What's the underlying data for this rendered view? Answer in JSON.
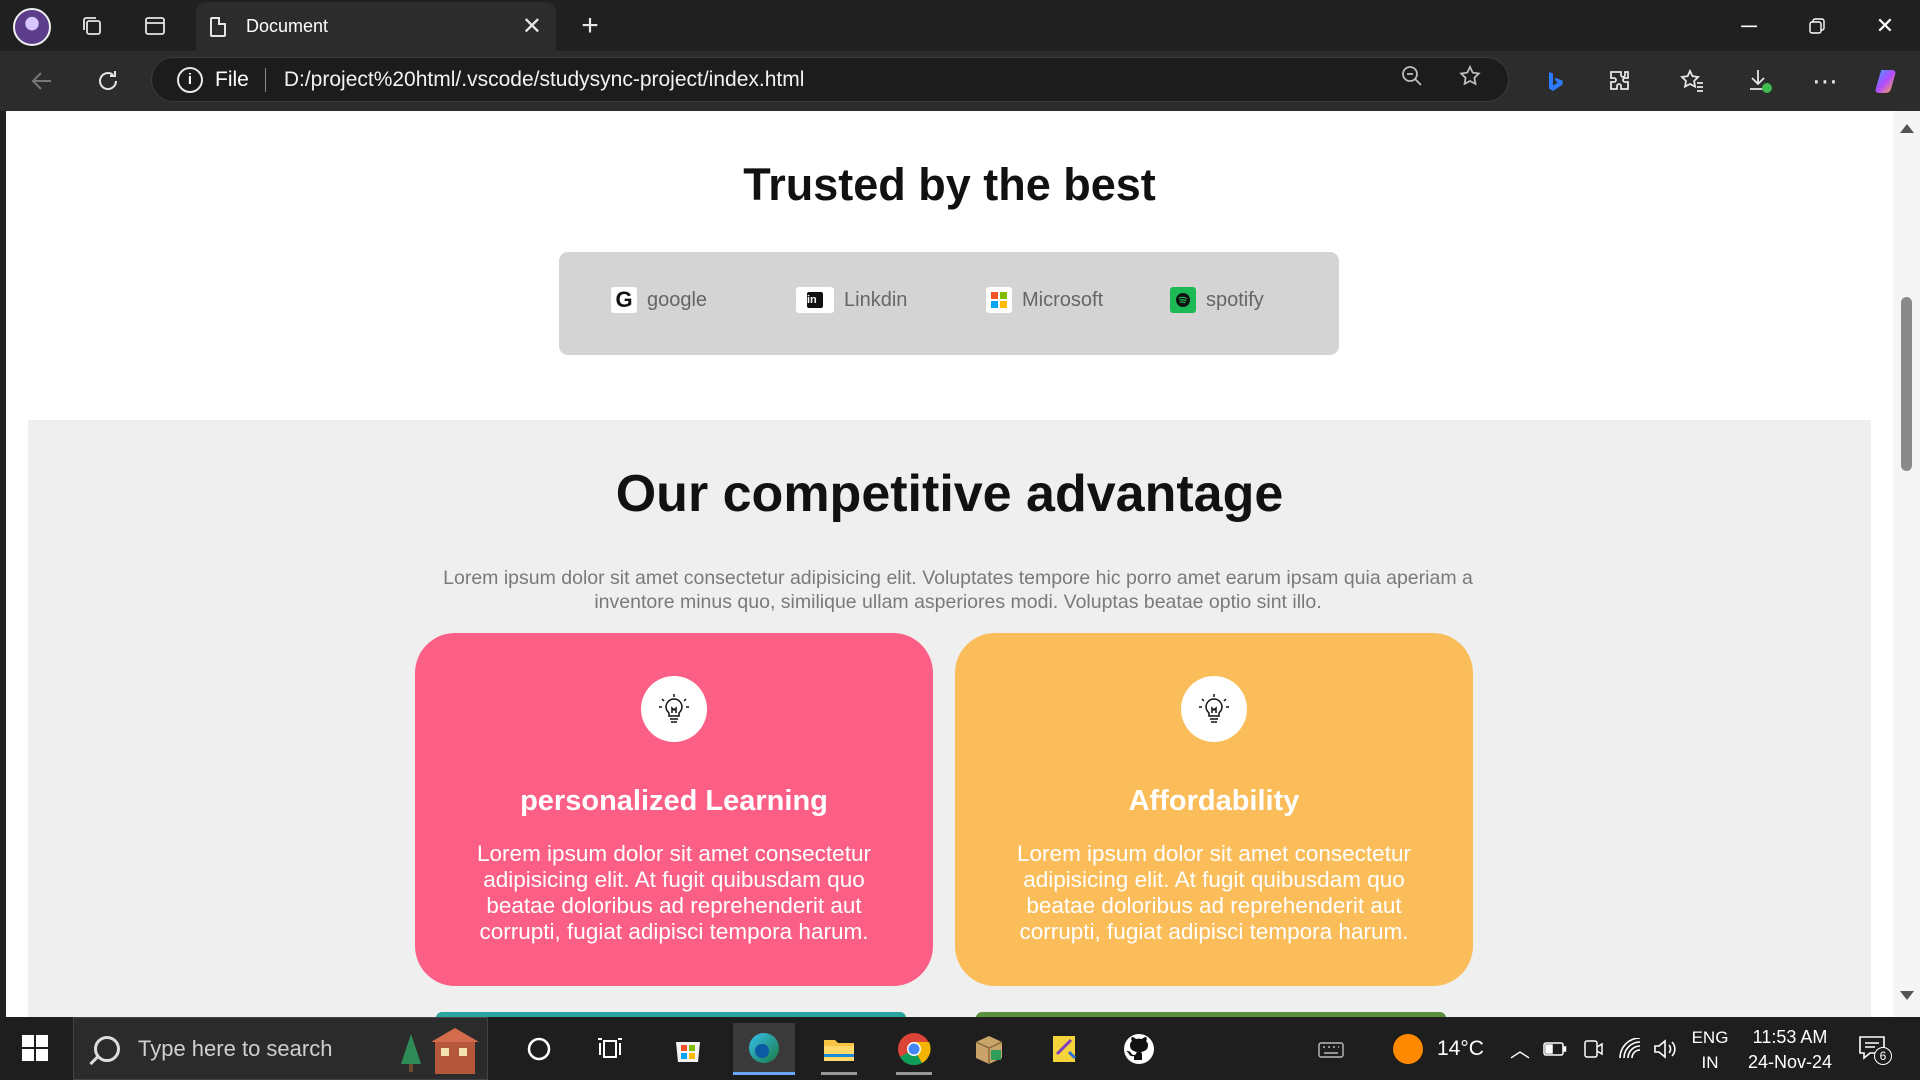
{
  "browser": {
    "tab_title": "Document",
    "omnibox_scheme": "File",
    "url": "D:/project%20html/.vscode/studysync-project/index.html"
  },
  "page": {
    "trusted_title": "Trusted by the best",
    "logos": [
      {
        "name": "google",
        "icon": "google-icon"
      },
      {
        "name": "Linkdin",
        "icon": "linkedin-icon"
      },
      {
        "name": "Microsoft",
        "icon": "microsoft-icon"
      },
      {
        "name": "spotify",
        "icon": "spotify-icon"
      }
    ],
    "advantage_title": "Our competitive advantage",
    "advantage_desc": "Lorem ipsum dolor sit amet consectetur adipisicing elit. Voluptates tempore hic porro amet earum ipsam quia aperiam a inventore minus quo, similique ullam asperiores modi. Voluptas beatae optio sint illo.",
    "cards": [
      {
        "title": "personalized Learning",
        "text": "Lorem ipsum dolor sit amet consectetur adipisicing elit. At fugit quibusdam quo beatae doloribus ad reprehenderit aut corrupti, fugiat adipisci tempora harum.",
        "color": "#fc5f85",
        "icon": "lightbulb-icon"
      },
      {
        "title": "Affordability",
        "text": "Lorem ipsum dolor sit amet consectetur adipisicing elit. At fugit quibusdam quo beatae doloribus ad reprehenderit aut corrupti, fugiat adipisci tempora harum.",
        "color": "#fbbd5a",
        "icon": "lightbulb-icon"
      }
    ]
  },
  "taskbar": {
    "search_placeholder": "Type here to search",
    "weather_temp": "14°C",
    "lang_line1": "ENG",
    "lang_line2": "IN",
    "time": "11:53 AM",
    "date": "24-Nov-24",
    "notification_count": "6"
  },
  "colors": {
    "card_pink": "#fc5f85",
    "card_orange": "#fbbd5a",
    "card_teal": "#2aa5a0",
    "card_green": "#5a8f3c"
  }
}
